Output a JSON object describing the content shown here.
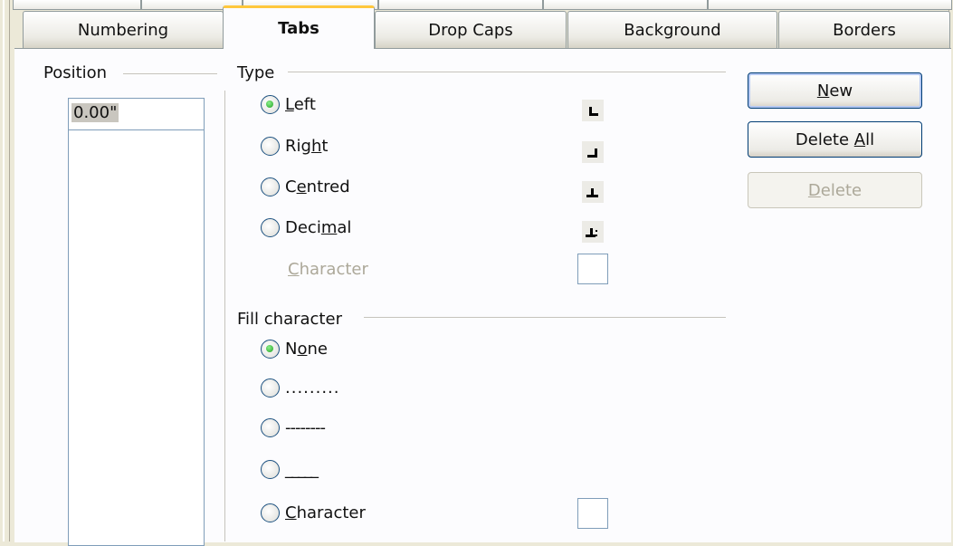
{
  "tabs": [
    {
      "label": "Numbering",
      "active": false
    },
    {
      "label": "Tabs",
      "active": true
    },
    {
      "label": "Drop Caps",
      "active": false
    },
    {
      "label": "Background",
      "active": false
    },
    {
      "label": "Borders",
      "active": false
    }
  ],
  "position": {
    "section_label": "Position",
    "value": "0.00\""
  },
  "type": {
    "section_label": "Type",
    "options": [
      {
        "label": "Left",
        "mnemonic": "L",
        "checked": true,
        "icon": "tab-left-icon"
      },
      {
        "label": "Right",
        "mnemonic": "h",
        "checked": false,
        "icon": "tab-right-icon"
      },
      {
        "label": "Centred",
        "mnemonic": "e",
        "checked": false,
        "icon": "tab-center-icon"
      },
      {
        "label": "Decimal",
        "mnemonic": "m",
        "checked": false,
        "icon": "tab-decimal-icon"
      }
    ],
    "character_label": "Character",
    "character_value": ""
  },
  "fill": {
    "section_label": "Fill character",
    "options": [
      {
        "label": "None",
        "checked": true
      },
      {
        "label": ".........",
        "checked": false
      },
      {
        "label": "--------",
        "checked": false
      },
      {
        "label": "_____",
        "checked": false
      },
      {
        "label": "Character",
        "checked": false
      }
    ],
    "character_value": ""
  },
  "buttons": {
    "new": "New",
    "delete_all": "Delete All",
    "delete": "Delete"
  },
  "colors": {
    "accent": "#ffc73c",
    "radio_check": "#21a121",
    "panel_bg": "#fcfcfe",
    "window_bg": "#ece9d8"
  }
}
